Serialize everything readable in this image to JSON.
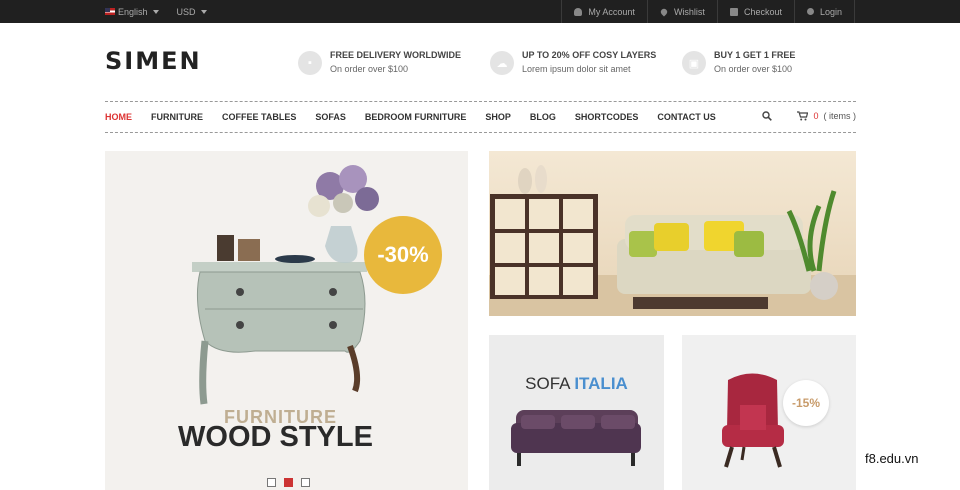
{
  "topbar": {
    "language": "English",
    "currency": "USD",
    "links": [
      {
        "label": "My Account",
        "icon": "user-icon"
      },
      {
        "label": "Wishlist",
        "icon": "heart-icon"
      },
      {
        "label": "Checkout",
        "icon": "check-icon"
      },
      {
        "label": "Login",
        "icon": "key-icon"
      }
    ]
  },
  "header": {
    "logo": "SIMEN",
    "promos": [
      {
        "title": "FREE DELIVERY WORLDWIDE",
        "subtitle": "On order over $100",
        "icon": "truck-icon"
      },
      {
        "title": "UP TO 20% OFF COSY LAYERS",
        "subtitle": "Lorem ipsum dolor sit amet",
        "icon": "cloud-icon"
      },
      {
        "title": "BUY 1 GET 1 FREE",
        "subtitle": "On order over $100",
        "icon": "gift-icon"
      }
    ]
  },
  "nav": {
    "items": [
      "HOME",
      "FURNITURE",
      "COFFEE TABLES",
      "SOFAS",
      "BEDROOM FURNITURE",
      "SHOP",
      "BLOG",
      "SHORTCODES",
      "CONTACT US"
    ],
    "active_index": 0,
    "cart_count": "0",
    "cart_suffix": "( items )"
  },
  "hero": {
    "sale": "-30%",
    "subtitle": "FURNITURE",
    "title": "WOOD STYLE",
    "slide_count": 3,
    "active_slide": 1
  },
  "banners": {
    "sofa_text": "SOFA",
    "sofa_accent": "ITALIA",
    "chair_sale": "-15%"
  },
  "watermark": "f8.edu.vn",
  "colors": {
    "accent": "#d33333",
    "sale_badge": "#e8b83c",
    "topbar": "#202020"
  }
}
